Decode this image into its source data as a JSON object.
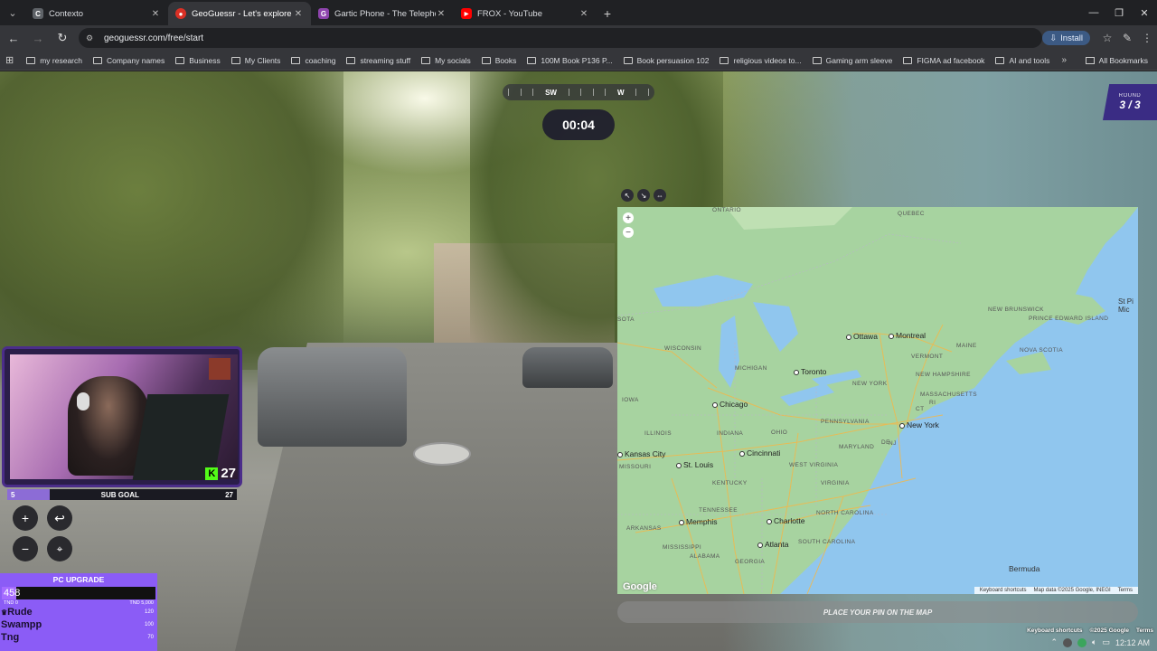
{
  "browser": {
    "tabs": [
      {
        "title": "Contexto",
        "fav_color": "#5f6368",
        "fav_glyph": "C",
        "active": false
      },
      {
        "title": "GeoGuessr - Let's explore the w",
        "fav_color": "#d93025",
        "fav_glyph": "G",
        "active": true
      },
      {
        "title": "Gartic Phone - The Telephone G",
        "fav_color": "#8e44ad",
        "fav_glyph": "G",
        "active": false
      },
      {
        "title": "FROX - YouTube",
        "fav_color": "#ff0000",
        "fav_glyph": "▶",
        "active": false
      }
    ],
    "url": "geoguessr.com/free/start",
    "install_label": "Install",
    "bookmarks": [
      "my research",
      "Company names",
      "Business",
      "My Clients",
      "coaching",
      "streaming stuff",
      "My socials",
      "Books",
      "100M Book P136 P...",
      "Book persuasion 102",
      "religious videos to...",
      "Gaming arm sleeve",
      "FIGMA ad facebook",
      "AI and tools"
    ],
    "all_bookmarks": "All Bookmarks"
  },
  "game": {
    "compass_heading": "SW",
    "compass_next": "W",
    "timer": "00:04",
    "round_label": "ROUND",
    "round_value": "3 / 3",
    "place_pin": "PLACE YOUR PIN ON THE MAP"
  },
  "map": {
    "states": [
      "ONTARIO",
      "QUEBEC",
      "NEW BRUNSWICK",
      "PRINCE EDWARD ISLAND",
      "NOVA SCOTIA",
      "MAINE",
      "VERMONT",
      "NEW HAMPSHIRE",
      "MASSACHUSETTS",
      "CT",
      "RI",
      "NEW YORK",
      "NJ",
      "PENNSYLVANIA",
      "MARYLAND",
      "DE",
      "WISCONSIN",
      "MICHIGAN",
      "IOWA",
      "ILLINOIS",
      "INDIANA",
      "OHIO",
      "WEST VIRGINIA",
      "VIRGINIA",
      "MISSOURI",
      "KENTUCKY",
      "TENNESSEE",
      "NORTH CAROLINA",
      "SOUTH CAROLINA",
      "ARKANSAS",
      "MISSISSIPPI",
      "ALABAMA",
      "GEORGIA",
      "SOTA"
    ],
    "cities": [
      "Ottawa",
      "Montreal",
      "Toronto",
      "Chicago",
      "New York",
      "Kansas City",
      "St. Louis",
      "Cincinnati",
      "Charlotte",
      "Atlanta",
      "Memphis"
    ],
    "bermuda": "Bermuda",
    "st_pierre": "St Pi\nMic",
    "google_logo": "Google",
    "footer": [
      "Keyboard shortcuts",
      "Map data ©2025 Google, INEGI",
      "Terms"
    ]
  },
  "stream": {
    "kick_count": "27",
    "subgoal_label": "SUB GOAL",
    "subgoal_current": "5",
    "subgoal_target": "27",
    "subgoal_fraction": 0.185,
    "pc_upgrade_title": "PC UPGRADE",
    "pc_upgrade_value": "458",
    "pc_upgrade_fraction": 0.0916,
    "pc_upgrade_min": "TND 0",
    "pc_upgrade_max": "TND 5,000",
    "donors": [
      {
        "name": "Rude",
        "amount": "120"
      },
      {
        "name": "Swampp",
        "amount": "100"
      },
      {
        "name": "Tng",
        "amount": "70"
      }
    ]
  },
  "gmaps_footer": [
    "Keyboard shortcuts",
    "©2025 Google",
    "Terms"
  ],
  "clock": "12:12 AM"
}
